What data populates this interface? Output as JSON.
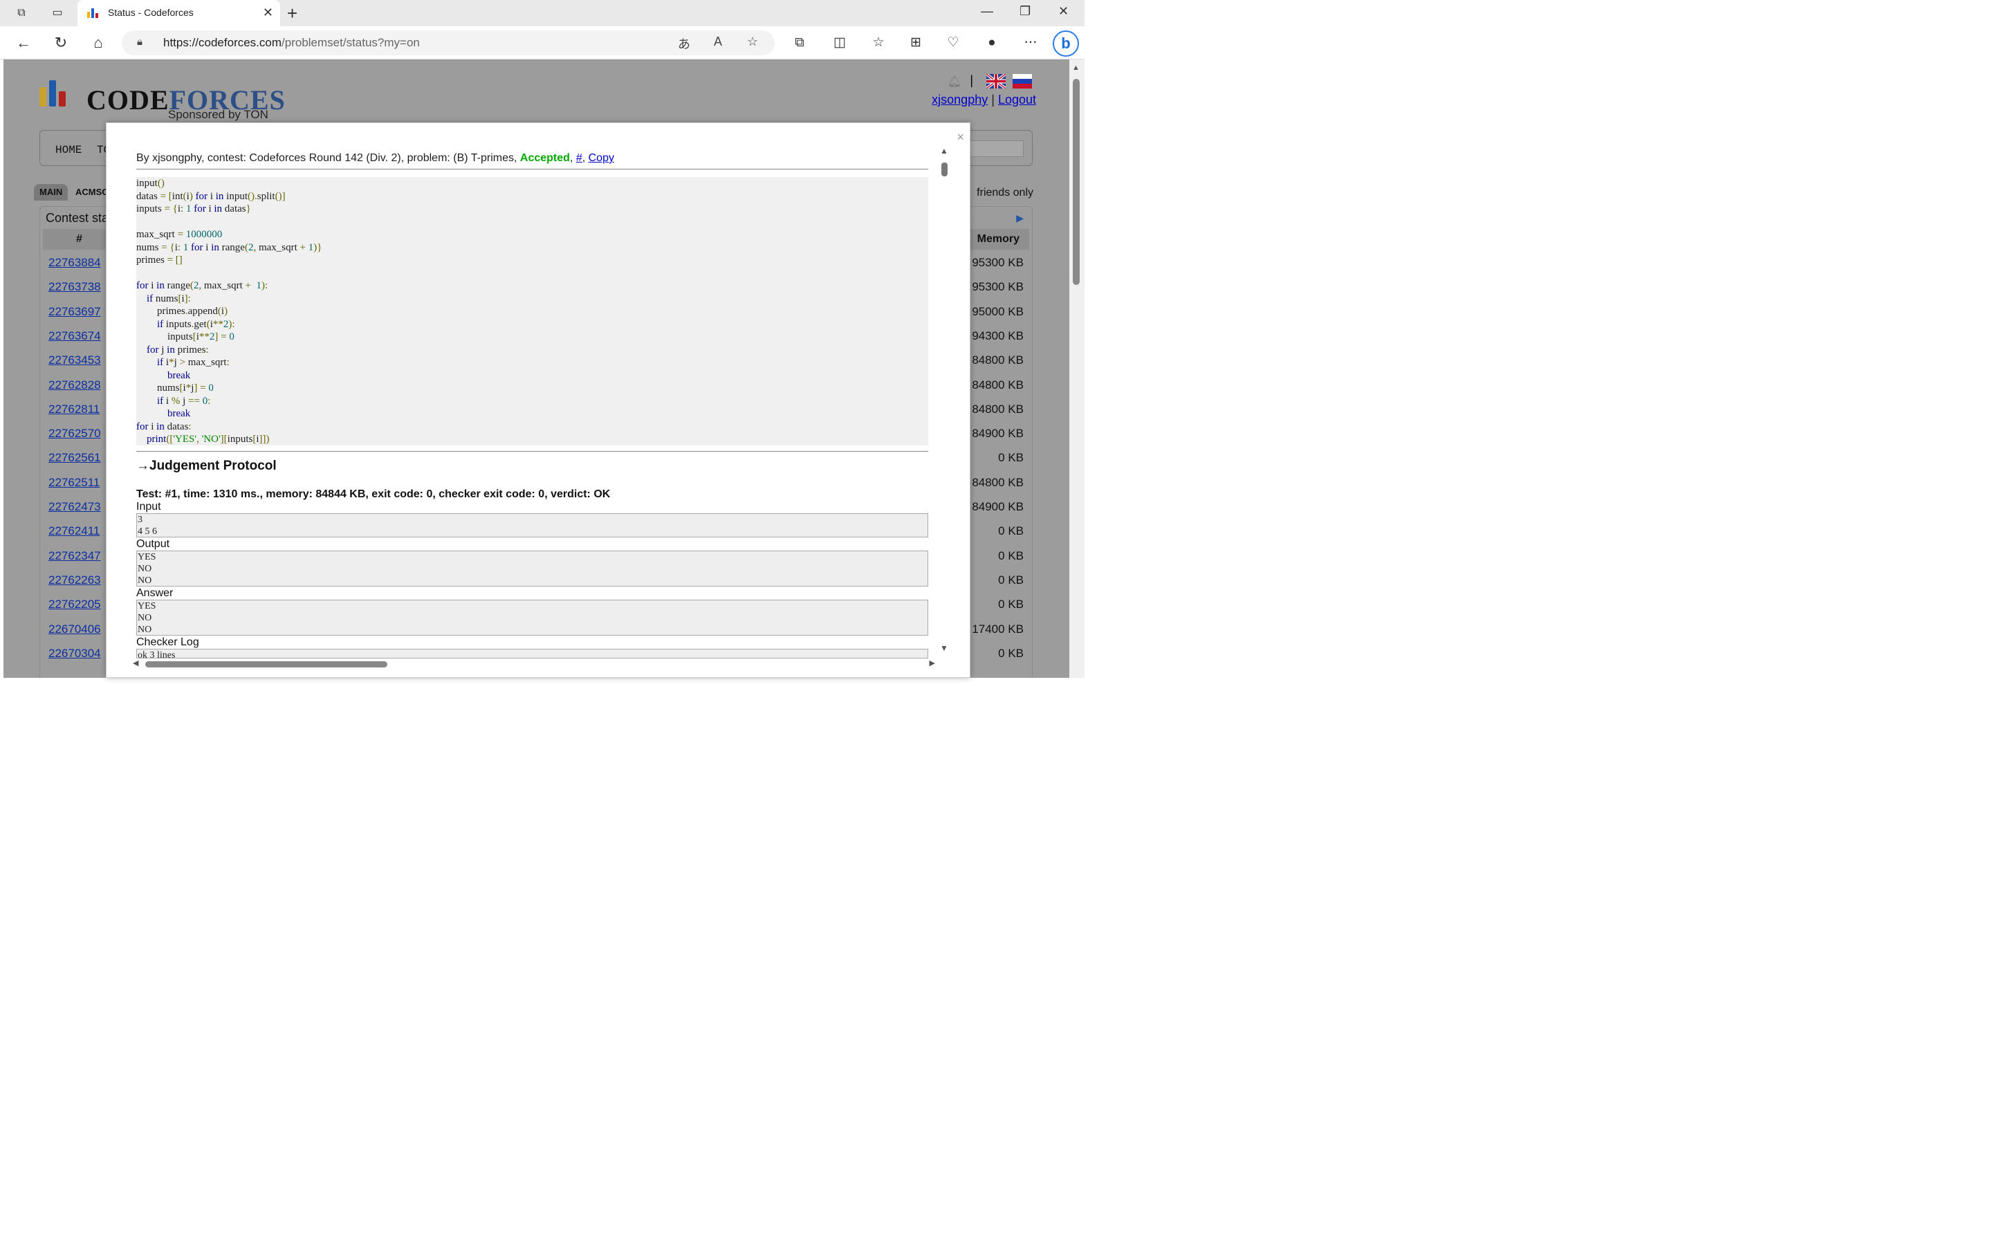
{
  "browser": {
    "tab_title": "Status - Codeforces",
    "url_domain": "https://codeforces.com",
    "url_path": "/problemset/status?my=on"
  },
  "site": {
    "logo_code": "CODE",
    "logo_forces": "FORCES",
    "sponsored": "Sponsored by TON",
    "username": "xjsongphy",
    "separator": "|",
    "logout": "Logout",
    "menu_home": "HOME",
    "menu_top": "TO",
    "subtab_main": "MAIN",
    "subtab_acmsguru": "ACMSGUR",
    "friends_only": "friends only",
    "table_title": "Contest sta",
    "col_id": "#",
    "col_memory": "Memory"
  },
  "rows": [
    {
      "id": "22763884",
      "mem": "95300 KB"
    },
    {
      "id": "22763738",
      "mem": "95300 KB"
    },
    {
      "id": "22763697",
      "mem": "95000 KB"
    },
    {
      "id": "22763674",
      "mem": "94300 KB"
    },
    {
      "id": "22763453",
      "mem": "84800 KB"
    },
    {
      "id": "22762828",
      "mem": "84800 KB"
    },
    {
      "id": "22762811",
      "mem": "84800 KB"
    },
    {
      "id": "22762570",
      "mem": "84900 KB"
    },
    {
      "id": "22762561",
      "mem": "0 KB"
    },
    {
      "id": "22762511",
      "mem": "84800 KB"
    },
    {
      "id": "22762473",
      "mem": "84900 KB"
    },
    {
      "id": "22762411",
      "mem": "0 KB"
    },
    {
      "id": "22762347",
      "mem": "0 KB"
    },
    {
      "id": "22762263",
      "mem": "0 KB"
    },
    {
      "id": "22762205",
      "mem": "0 KB"
    },
    {
      "id": "22670406",
      "mem": "17400 KB"
    },
    {
      "id": "22670304",
      "mem": "0 KB"
    }
  ],
  "modal": {
    "close": "×",
    "header_prefix": "By xjsongphy, contest: Codeforces Round 142 (Div. 2), problem: (B) T-primes, ",
    "verdict": "Accepted",
    "comma1": ", ",
    "hash_link": "#",
    "comma2": ", ",
    "copy_link": "Copy",
    "code_lines": [
      "input()",
      "datas = [int(i) for i in input().split()]",
      "inputs = {i: 1 for i in datas}",
      "",
      "max_sqrt = 1000000",
      "nums = {i: 1 for i in range(2, max_sqrt + 1)}",
      "primes = []",
      "",
      "for i in range(2, max_sqrt +  1):",
      "    if nums[i]:",
      "        primes.append(i)",
      "        if inputs.get(i**2):",
      "            inputs[i**2] = 0",
      "    for j in primes:",
      "        if i*j > max_sqrt:",
      "            break",
      "        nums[i*j] = 0",
      "        if i % j == 0:",
      "            break",
      "for i in datas:",
      "    print(['YES', 'NO'][inputs[i]])"
    ],
    "judgement_title": "→Judgement Protocol",
    "test_line": "Test: #1, time: 1310 ms., memory: 84844 KB, exit code: 0, checker exit code: 0, verdict: OK",
    "input_label": "Input",
    "input_text": "3\n4 5 6",
    "output_label": "Output",
    "output_text": "YES\nNO\nNO",
    "answer_label": "Answer",
    "answer_text": "YES\nNO\nNO",
    "checker_label": "Checker Log",
    "checker_text": "ok 3 lines"
  },
  "colors": {
    "accepted": "#00aa00",
    "link": "#0000cc",
    "overlay_bg": "#9c9c9c"
  }
}
